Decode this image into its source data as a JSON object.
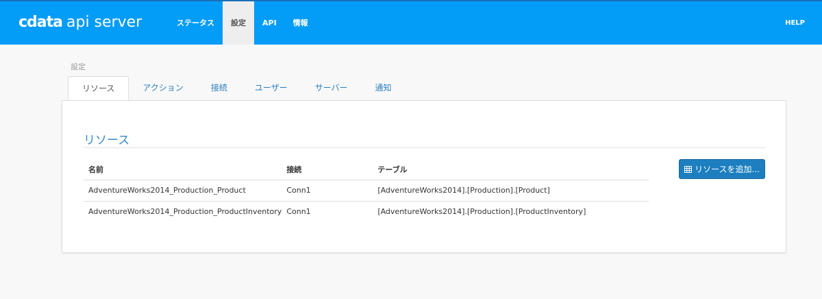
{
  "header": {
    "logo_brand": "cdata",
    "logo_product": "api server",
    "nav": [
      {
        "label": "ステータス"
      },
      {
        "label": "設定",
        "active": true
      },
      {
        "label": "API"
      },
      {
        "label": "情報"
      }
    ],
    "help": "HELP"
  },
  "breadcrumb": "設定",
  "tabs": [
    "リソース",
    "アクション",
    "接続",
    "ユーザー",
    "サーバー",
    "通知"
  ],
  "panel": {
    "title": "リソース",
    "add_button": "リソースを追加...",
    "columns": [
      "名前",
      "接続",
      "テーブル"
    ],
    "rows": [
      [
        "AdventureWorks2014_Production_Product",
        "Conn1",
        "[AdventureWorks2014].[Production].[Product]"
      ],
      [
        "AdventureWorks2014_Production_ProductInventory",
        "Conn1",
        "[AdventureWorks2014].[Production].[ProductInventory]"
      ]
    ]
  }
}
